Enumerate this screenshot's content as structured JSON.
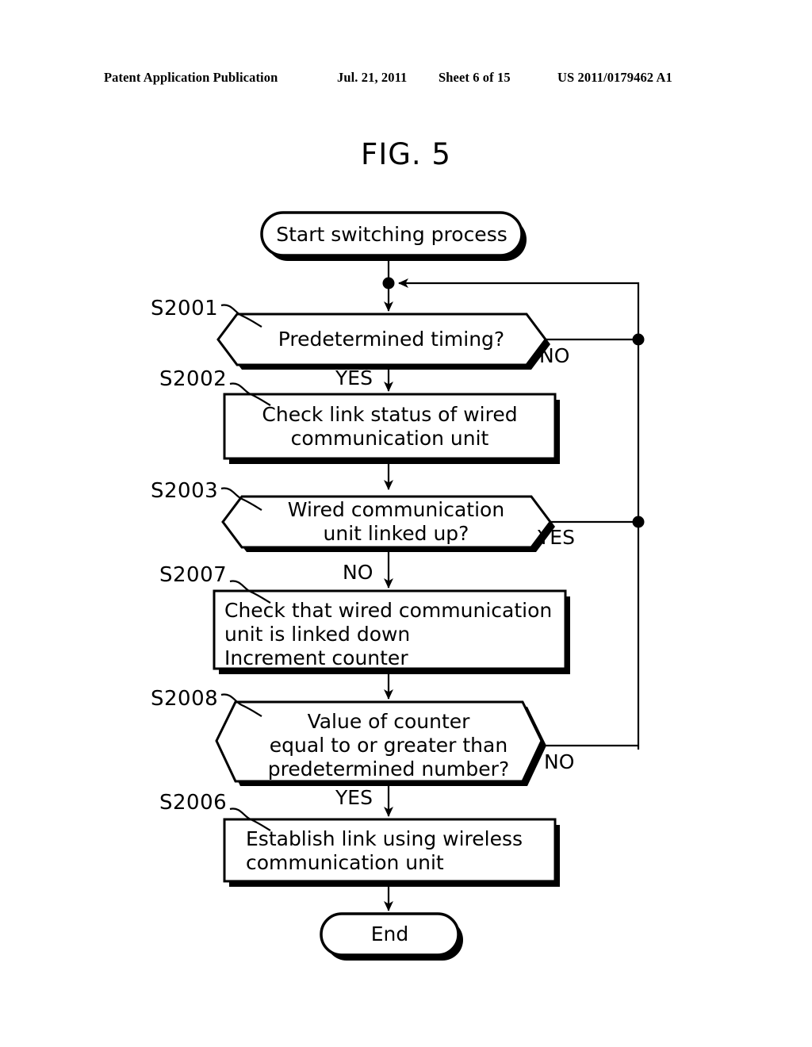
{
  "header": {
    "publication": "Patent Application Publication",
    "date": "Jul. 21, 2011",
    "sheet": "Sheet 6 of 15",
    "patent_number": "US 2011/0179462 A1"
  },
  "figure": {
    "title": "FIG. 5"
  },
  "flowchart": {
    "nodes": {
      "start": {
        "step": "",
        "text": "Start switching process",
        "shape": "terminator"
      },
      "s2001": {
        "step": "S2001",
        "text": "Predetermined timing?",
        "shape": "decision-hexagon",
        "yes": "YES",
        "no": "NO"
      },
      "s2002": {
        "step": "S2002",
        "text": "Check link status of wired\ncommunication unit",
        "shape": "process"
      },
      "s2003": {
        "step": "S2003",
        "text": "Wired communication\nunit linked up?",
        "shape": "decision-hexagon",
        "yes": "YES",
        "no": "NO"
      },
      "s2007": {
        "step": "S2007",
        "text": "Check that wired communication\nunit is linked down\nIncrement counter",
        "shape": "process"
      },
      "s2008": {
        "step": "S2008",
        "text": "Value of counter\nequal to or greater than\npredetermined number?",
        "shape": "decision-hexagon",
        "yes": "YES",
        "no": "NO"
      },
      "s2006": {
        "step": "S2006",
        "text": "Establish link using wireless\ncommunication unit",
        "shape": "process"
      },
      "end": {
        "step": "",
        "text": "End",
        "shape": "terminator"
      }
    },
    "colors": {
      "stroke": "#000000",
      "fill": "#ffffff"
    }
  }
}
